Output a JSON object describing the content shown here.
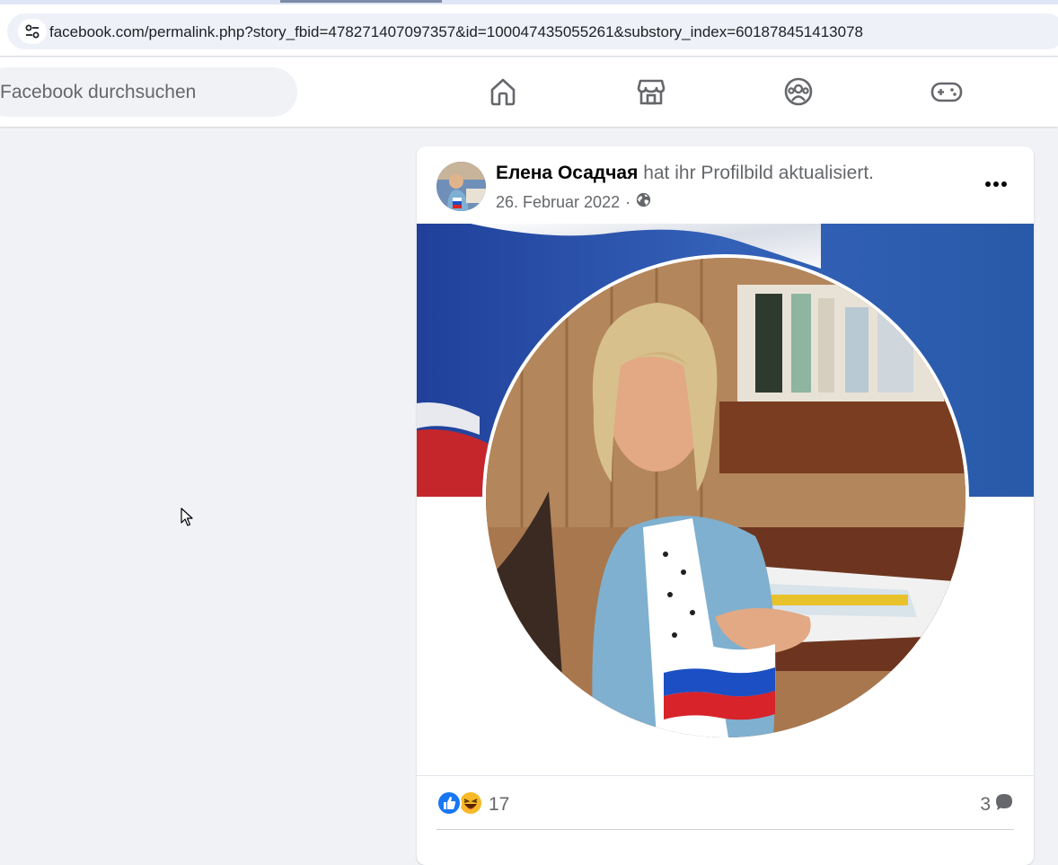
{
  "browser": {
    "url": "facebook.com/permalink.php?story_fbid=478271407097357&id=100047435055261&substory_index=601878451413078",
    "site_info_icon": "tune-icon"
  },
  "topbar": {
    "search_placeholder": "Facebook durchsuchen",
    "nav": [
      {
        "icon": "home-icon"
      },
      {
        "icon": "marketplace-icon"
      },
      {
        "icon": "groups-icon"
      },
      {
        "icon": "gaming-icon"
      }
    ]
  },
  "post": {
    "author": "Елена Осадчая",
    "action": "hat ihr Profilbild aktualisiert.",
    "date": "26. Februar 2022",
    "separator": "·",
    "audience_icon": "globe-icon",
    "more_icon": "more-horizontal-icon",
    "reactions": {
      "icons": [
        "like-icon",
        "haha-icon"
      ],
      "count": "17"
    },
    "comments": {
      "count": "3",
      "icon": "comment-icon"
    }
  },
  "colors": {
    "accent": "#1877f2",
    "page_bg": "#f0f2f5",
    "secondary_text": "#65676b"
  }
}
